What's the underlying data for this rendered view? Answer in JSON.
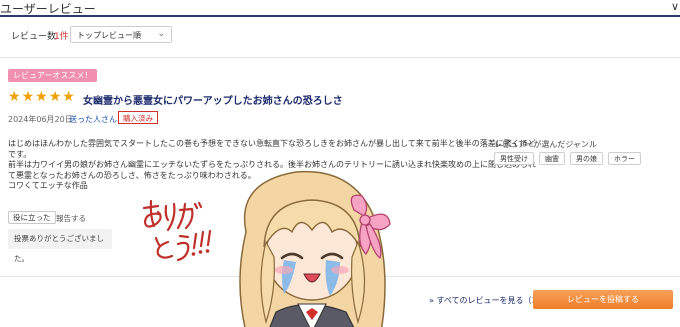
{
  "header": {
    "section_title": "ユーザーレビュー",
    "edge_glyph": "∨"
  },
  "toolbar": {
    "count_label": "レビュー数",
    "count_value": "1件",
    "sort_selected": "トップレビュー順",
    "sort_chevron": "⌄"
  },
  "review": {
    "badge": "レビュアーオススメ！",
    "rating": 5,
    "stars": [
      "★",
      "★",
      "★",
      "★",
      "★"
    ],
    "title": "女幽霊から悪霊女にパワーアップしたお姉さんの恐ろしさ",
    "date": "2024年06月20日",
    "author": "送った人",
    "author_suffix": "さん",
    "purchase_badge": "購入済み",
    "body_lines": [
      "はじめはほんわかした雰囲気でスタートしたこの巻も予想をできない急転直下な恐ろしきをお姉さんが暴し出して来て前半と後半の落差に驚くほど",
      "です。",
      "前半は力ワイイ男の娘がお姉さん幽霊にエッチないたずらをたっぷりされる。後半お姉さんのテリトリーに誘い込まれ快楽攻めの上に閉じ込められ",
      "て悪霊となったお姉さんの恐ろしさ、怖さをたっぷり味わわされる。",
      "コワくてエッチな作品"
    ],
    "genre_title": "レビュアーが選んだジャンル",
    "genres": [
      "男性受け",
      "幽霊",
      "男の娘",
      "ホラー"
    ],
    "helpful_button": "役に立った",
    "report_link": "報告する",
    "thanks_message": "投票ありがとうございました。"
  },
  "footer": {
    "all_reviews_link": "» すべてのレビューを見る（1）",
    "post_button": "レビューを投稿する"
  },
  "overlay": {
    "handwritten_text": "ありがとう!!!"
  },
  "colors": {
    "accent_navy": "#1a2a6c",
    "link_blue": "#1a4fb0",
    "count_red": "#d0312d",
    "badge_pink": "#f08fb0",
    "star_gold": "#f0a000",
    "button_orange": "#ef7f2a",
    "handwriting_red": "#c0302a"
  }
}
